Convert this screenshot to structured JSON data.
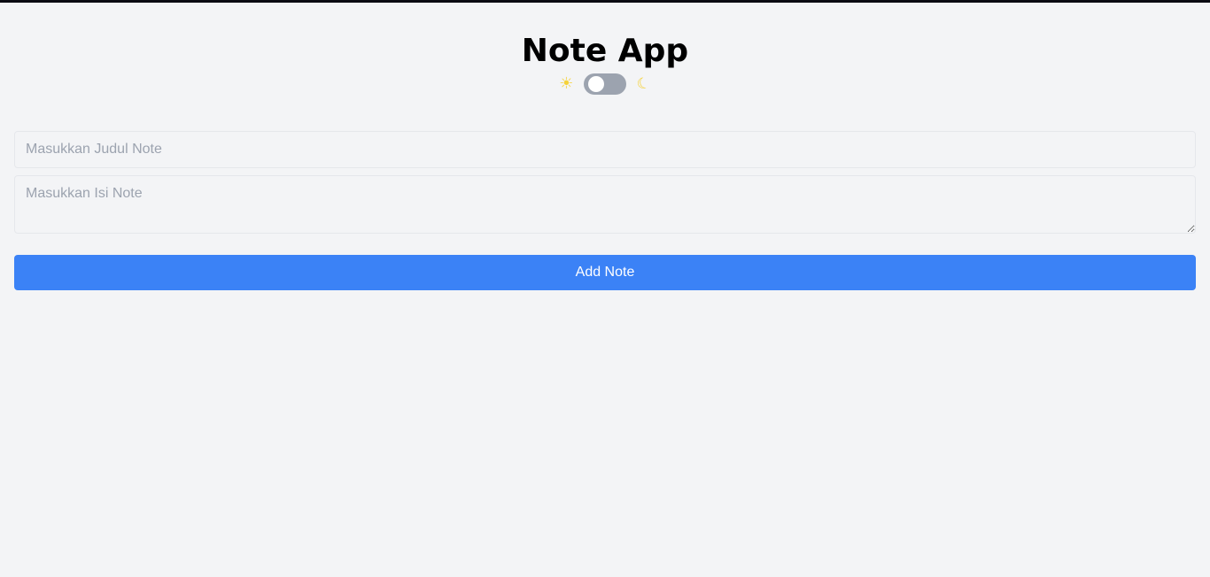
{
  "app": {
    "title": "Note App"
  },
  "theme_toggle": {
    "light_icon": "sun-icon",
    "dark_icon": "moon-icon",
    "state": "light",
    "track_color": "#9ca3af",
    "icon_color": "#f5d23a"
  },
  "form": {
    "title_placeholder": "Masukkan Judul Note",
    "title_value": "",
    "body_placeholder": "Masukkan Isi Note",
    "body_value": "",
    "submit_label": "Add Note",
    "submit_color": "#3b82f6"
  },
  "colors": {
    "background": "#f3f4f6",
    "accent": "#3b82f6"
  }
}
